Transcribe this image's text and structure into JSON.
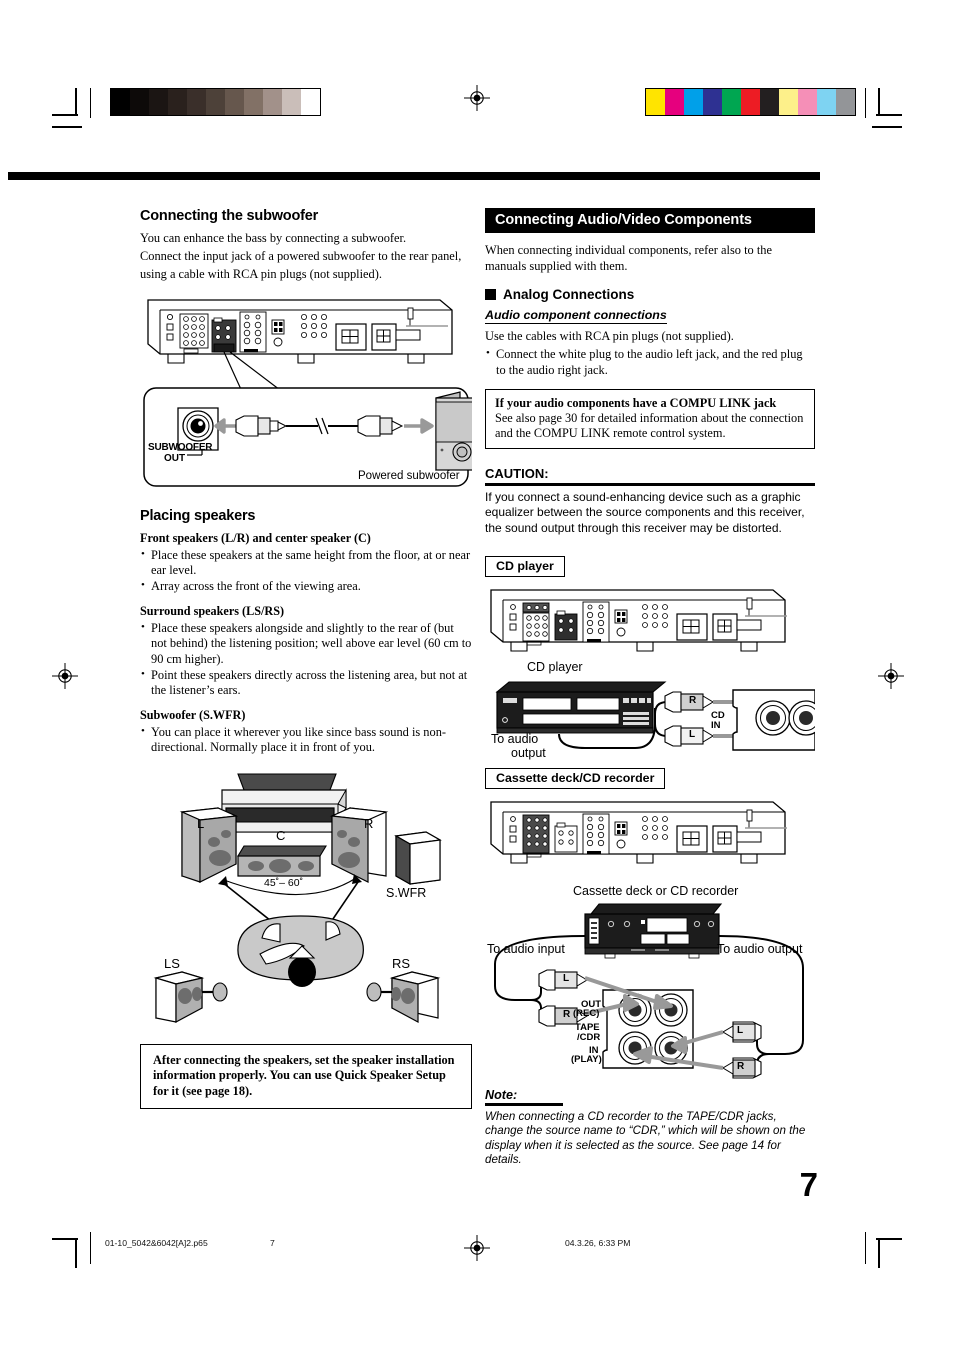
{
  "page": {
    "number": "7",
    "footer": {
      "filename": "01-10_5042&6042[A]2.p65",
      "page_mark": "7",
      "timestamp": "04.3.26, 6:33 PM"
    },
    "calibration": {
      "grayscale": [
        "#000000",
        "#0d0a09",
        "#1b1513",
        "#2a211d",
        "#3a2f2a",
        "#4d4139",
        "#66574d",
        "#827166",
        "#a2918a",
        "#cabeb9",
        "#ffffff"
      ],
      "colorbars": [
        "#ffe400",
        "#e6007e",
        "#00a0e9",
        "#2e3192",
        "#00a651",
        "#ed1c24",
        "#231f20",
        "#fdf08a",
        "#f58fb7",
        "#7ed3f2",
        "#939598"
      ]
    }
  },
  "left_column": {
    "heading": "Connecting the subwoofer",
    "intro": [
      "You can enhance the bass by connecting a subwoofer.",
      "Connect the input jack of a powered subwoofer to the rear panel,",
      "using a cable with RCA pin plugs (not supplied)."
    ],
    "subwoofer_diagram": {
      "jack_label_line1": "SUBWOOFER",
      "jack_label_line2": "OUT",
      "device_label": "Powered subwoofer"
    },
    "placing": {
      "heading": "Placing speakers",
      "groups": [
        {
          "title": "Front speakers (L/R) and center speaker (C)",
          "bullets": [
            "Place these speakers at the same height from the floor, at or near ear level.",
            "Array across the front of the viewing area."
          ]
        },
        {
          "title": "Surround speakers (LS/RS)",
          "bullets": [
            "Place these speakers alongside and slightly to the rear of (but not behind) the listening position; well above ear level (60 cm to 90 cm higher).",
            "Point these speakers directly across the listening area, but not at the listener’s ears."
          ]
        },
        {
          "title": "Subwoofer (S.WFR)",
          "bullets": [
            "You can place it wherever you like since bass sound is non-directional. Normally place it in front of you."
          ]
        }
      ]
    },
    "layout_diagram": {
      "speaker_left": "L",
      "speaker_right": "R",
      "speaker_center": "C",
      "speaker_subwoofer": "S.WFR",
      "speaker_ls": "LS",
      "speaker_rs": "RS",
      "angle": "45˚– 60˚"
    },
    "tip_box": "After connecting the speakers, set the speaker installation information properly. You can use Quick Speaker Setup for it (see page 18)."
  },
  "right_column": {
    "heading": "Connecting Audio/Video Components",
    "intro": "When connecting individual components, refer also to the manuals supplied with them.",
    "analog": {
      "heading": "Analog Connections",
      "subheading": "Audio component connections",
      "line": "Use the cables with RCA pin plugs (not supplied).",
      "bullet": "Connect the white plug to the audio left jack, and the red plug to the audio right jack."
    },
    "compu_link": {
      "title": "If your audio components have a COMPU LINK jack",
      "body": "See also page 30 for detailed information about the connection and the COMPU LINK remote control system."
    },
    "caution": {
      "heading": "CAUTION:",
      "body": "If you connect a sound-enhancing device such as a graphic equalizer between the source components and this receiver, the sound output through this receiver may be distorted."
    },
    "cd_player": {
      "callout": "CD player",
      "device_label": "CD player",
      "to_label_line1": "To audio",
      "to_label_line2": "output",
      "jack_label_line1": "CD",
      "jack_label_line2": "IN",
      "plug_r": "R",
      "plug_l": "L"
    },
    "cassette": {
      "callout": "Cassette deck/CD recorder",
      "device_label": "Cassette deck or CD recorder",
      "to_input": "To audio input",
      "to_output": "To audio output",
      "jack_out_line1": "OUT",
      "jack_out_line2": "(REC)",
      "jack_mid_line1": "TAPE",
      "jack_mid_line2": "/CDR",
      "jack_in_line1": "IN",
      "jack_in_line2": "(PLAY)",
      "plug_tl": "L",
      "plug_bl": "R",
      "plug_tr": "L",
      "plug_br": "R"
    },
    "note": {
      "heading": "Note:",
      "body": "When connecting a CD recorder to the TAPE/CDR jacks, change the source name to “CDR,” which will be shown on the display when it is selected as the source. See page 14 for details."
    }
  }
}
